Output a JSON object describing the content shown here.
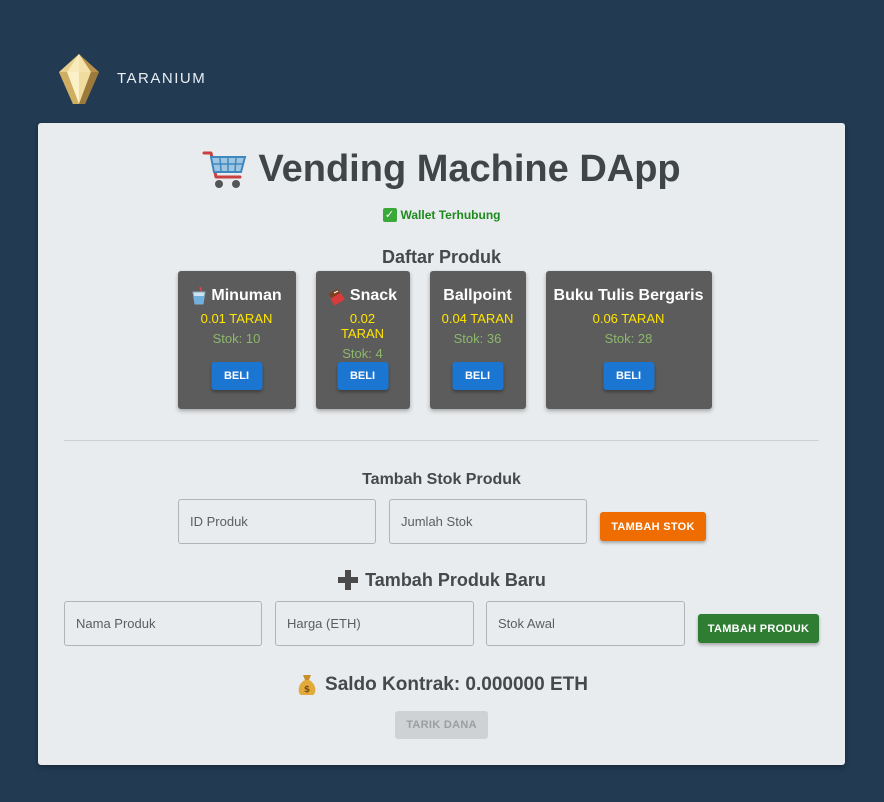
{
  "brand": {
    "name": "TARANIUM",
    "colors": {
      "gold": "#d9b86a",
      "navy": "#223b53"
    }
  },
  "header": {
    "title": "Vending Machine DApp",
    "title_icon": "shopping-cart-icon"
  },
  "wallet": {
    "status": "Wallet Terhubung",
    "icon": "check-mark-icon",
    "color": "#1e8a1e"
  },
  "products": {
    "title": "Daftar Produk",
    "items": [
      {
        "icon": "cup-icon",
        "name": "Minuman",
        "price": "0.01 TARAN",
        "stock": "Stok: 10",
        "buy": "BELI"
      },
      {
        "icon": "chocolate-icon",
        "name": "Snack",
        "price": "0.02 TARAN",
        "stock": "Stok: 4",
        "buy": "BELI"
      },
      {
        "icon": "",
        "name": "Ballpoint",
        "price": "0.04 TARAN",
        "stock": "Stok: 36",
        "buy": "BELI"
      },
      {
        "icon": "",
        "name": "Buku Tulis Bergaris",
        "price": "0.06 TARAN",
        "stock": "Stok: 28",
        "buy": "BELI"
      }
    ]
  },
  "restock": {
    "title": "Tambah Stok Produk",
    "id_placeholder": "ID Produk",
    "qty_placeholder": "Jumlah Stok",
    "button": "TAMBAH STOK",
    "button_color": "#ef6c00"
  },
  "add_product": {
    "title": "Tambah Produk Baru",
    "title_icon": "plus-icon",
    "name_placeholder": "Nama Produk",
    "price_placeholder": "Harga (ETH)",
    "stock_placeholder": "Stok Awal",
    "button": "TAMBAH PRODUK",
    "button_color": "#2e7d32"
  },
  "balance": {
    "text": "Saldo Kontrak: 0.000000 ETH",
    "icon": "money-bag-icon",
    "withdraw_button": "TARIK DANA"
  }
}
